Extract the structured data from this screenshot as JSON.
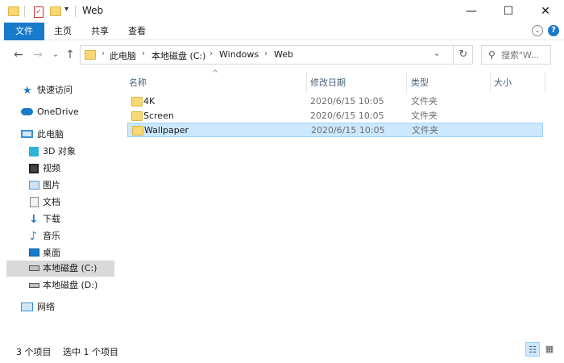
{
  "window": {
    "title": "Web",
    "minimize": "—",
    "maximize": "☐",
    "close": "✕"
  },
  "ribbon": {
    "tabs": [
      "文件",
      "主页",
      "共享",
      "查看"
    ],
    "expand": "⌄",
    "help": "?"
  },
  "nav": {
    "back": "←",
    "forward": "→",
    "recent": "⌄",
    "up": "↑"
  },
  "address": {
    "crumbs": [
      "此电脑",
      "本地磁盘 (C:)",
      "Windows",
      "Web"
    ],
    "separator": "›",
    "dropdown": "⌄",
    "refresh": "↻"
  },
  "search": {
    "icon": "search-icon",
    "placeholder": "搜索\"W..."
  },
  "sidebar": {
    "items": [
      {
        "label": "快速访问",
        "icon": "star-icon",
        "color": "#1979ca"
      },
      {
        "label": "OneDrive",
        "icon": "cloud-icon",
        "color": "#1979ca"
      },
      {
        "label": "此电脑",
        "icon": "computer-icon",
        "color": "#3a8fd8"
      },
      {
        "label": "3D 对象",
        "icon": "cube-icon",
        "color": "#2bb3d9"
      },
      {
        "label": "视频",
        "icon": "film-icon",
        "color": "#444444"
      },
      {
        "label": "图片",
        "icon": "picture-icon",
        "color": "#5a9bd5"
      },
      {
        "label": "文档",
        "icon": "document-icon",
        "color": "#888888"
      },
      {
        "label": "下载",
        "icon": "download-icon",
        "color": "#1979ca"
      },
      {
        "label": "音乐",
        "icon": "music-icon",
        "color": "#1979ca"
      },
      {
        "label": "桌面",
        "icon": "desktop-icon",
        "color": "#1979ca"
      },
      {
        "label": "本地磁盘 (C:)",
        "icon": "drive-c-icon",
        "color": "#555555"
      },
      {
        "label": "本地磁盘 (D:)",
        "icon": "drive-d-icon",
        "color": "#555555"
      },
      {
        "label": "网络",
        "icon": "network-icon",
        "color": "#3a8fd8"
      }
    ]
  },
  "list": {
    "columns": [
      "名称",
      "修改日期",
      "类型",
      "大小"
    ],
    "sort_indicator": "^",
    "rows": [
      {
        "name": "4K",
        "date": "2020/6/15 10:05",
        "type": "文件夹",
        "selected": false
      },
      {
        "name": "Screen",
        "date": "2020/6/15 10:05",
        "type": "文件夹",
        "selected": false
      },
      {
        "name": "Wallpaper",
        "date": "2020/6/15 10:05",
        "type": "文件夹",
        "selected": true
      }
    ]
  },
  "status": {
    "count": "3 个项目",
    "selection": "选中 1 个项目"
  },
  "view": {
    "details": "☷",
    "icons": "▦"
  },
  "colors": {
    "accent": "#1979ca",
    "selection_bg": "#cce8ff",
    "selection_border": "#99d1ff",
    "folder": "#f8d775"
  }
}
